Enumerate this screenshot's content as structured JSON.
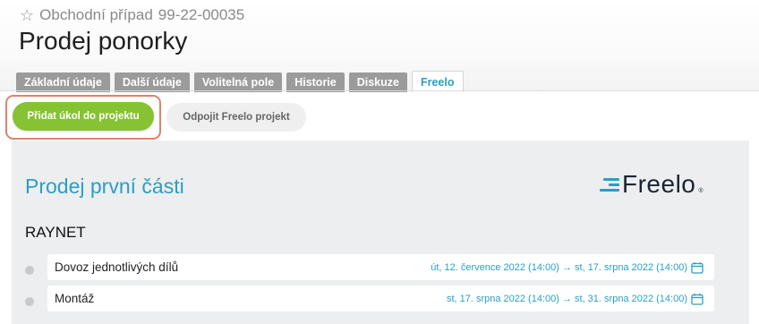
{
  "header": {
    "case_label": "Obchodní případ",
    "case_number": "99-22-00035",
    "title": "Prodej ponorky"
  },
  "tabs": [
    {
      "label": "Základní údaje",
      "active": false
    },
    {
      "label": "Další údaje",
      "active": false
    },
    {
      "label": "Volitelná pole",
      "active": false
    },
    {
      "label": "Historie",
      "active": false
    },
    {
      "label": "Diskuze",
      "active": false
    },
    {
      "label": "Freelo",
      "active": true
    }
  ],
  "actions": {
    "add_task_label": "Přidat úkol do projektu",
    "disconnect_label": "Odpojit Freelo projekt"
  },
  "project": {
    "title": "Prodej první části",
    "logo_text": "Freelo",
    "logo_reg": "®",
    "section_title": "RAYNET",
    "tasks": [
      {
        "name": "Dovoz jednotlivých dílů",
        "dates": "út, 12. července 2022 (14:00) → st, 17. srpna 2022 (14:00)"
      },
      {
        "name": "Montáž",
        "dates": "st, 17. srpna 2022 (14:00) → st, 31. srpna 2022 (14:00)"
      }
    ]
  },
  "colors": {
    "accent": "#2a9fc4",
    "primary_button": "#86c232",
    "highlight_border": "#e0826a",
    "tab_inactive": "#9b9b9b"
  },
  "icons": {
    "favorite": "star-outline-icon",
    "task_status": "circle-icon",
    "date": "calendar-icon"
  }
}
